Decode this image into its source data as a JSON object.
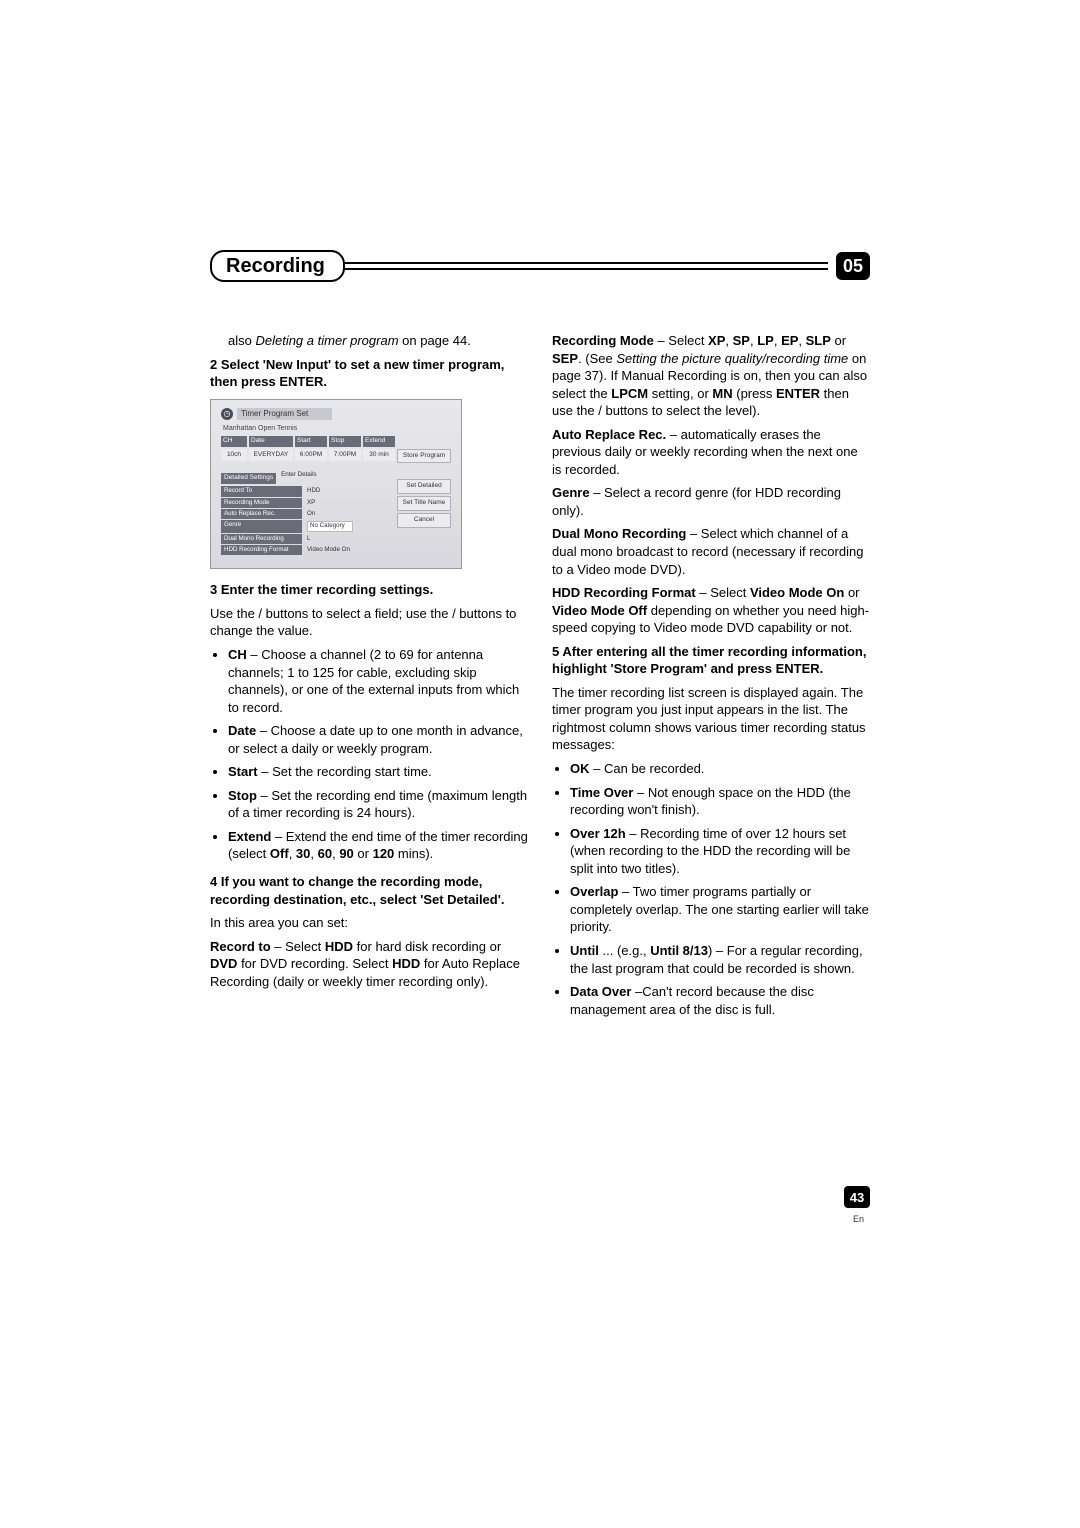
{
  "header": {
    "title": "Recording",
    "chapter": "05"
  },
  "footer": {
    "page": "43",
    "lang": "En"
  },
  "left": {
    "intro_also": "also ",
    "intro_ref_italic": "Deleting a timer program",
    "intro_after": " on page 44.",
    "step2": "2   Select 'New Input' to set a new timer program, then press ENTER.",
    "ui": {
      "panel_title": "Timer Program Set",
      "subtitle": "Manhattan Open Tennis",
      "cols": {
        "ch": "CH",
        "date": "Date",
        "start": "Start",
        "stop": "Stop",
        "extend": "Extend"
      },
      "vals": {
        "ch": "10ch",
        "date": "EVERYDAY",
        "start": "6:00PM",
        "stop": "7:00PM",
        "extend": "30 min"
      },
      "store_btn": "Store Program",
      "detailed_hdr": "Detailed Settings",
      "enter_details": "Enter Details",
      "rows": {
        "record_to_l": "Record To",
        "record_to_v": "HDD",
        "rec_mode_l": "Recording Mode",
        "rec_mode_v": "XP",
        "auto_l": "Auto Replace Rec.",
        "auto_v": "On",
        "genre_l": "Genre",
        "genre_v": "No Category",
        "dual_l": "Dual Mono Recording",
        "dual_v": "L",
        "hdd_l": "HDD Recording Format",
        "hdd_v": "Video Mode On"
      },
      "btns": {
        "set_detailed": "Set Detailed",
        "set_title": "Set Title Name",
        "cancel": "Cancel"
      }
    },
    "step3": "3   Enter the timer recording settings.",
    "step3_use": "Use the     /     buttons to select a field; use the     /     buttons to change the value.",
    "bul_ch_b": "CH",
    "bul_ch": " – Choose a channel (2 to 69 for antenna channels; 1 to 125 for cable, excluding skip channels), or one of the external inputs from which to record.",
    "bul_date_b": "Date",
    "bul_date": " – Choose a date up to one month in advance, or select a daily or weekly program.",
    "bul_start_b": "Start",
    "bul_start": " – Set the recording start time.",
    "bul_stop_b": "Stop",
    "bul_stop": " – Set the recording end time (maximum length of a timer recording is 24 hours).",
    "bul_ext_b": "Extend",
    "bul_ext_a": " – Extend the end time of the timer recording (select ",
    "bul_ext_off": "Off",
    "bul_ext_30": "30",
    "bul_ext_60": "60",
    "bul_ext_90": "90",
    "bul_ext_or": " or ",
    "bul_ext_120": "120",
    "bul_ext_mins": " mins).",
    "step4": "4   If you want to change the recording mode, recording destination, etc., select 'Set Detailed'.",
    "step4_p": "In this area you can set:",
    "rec_to_b": "Record to",
    "rec_to_a": " – Select ",
    "rec_to_hdd": "HDD",
    "rec_to_mid": " for hard disk recording or ",
    "rec_to_dvd": "DVD",
    "rec_to_c": " for DVD recording. Select ",
    "rec_to_hdd2": "HDD",
    "rec_to_d": "  for Auto Replace Recording (daily or weekly timer recording only)."
  },
  "right": {
    "rm_b": "Recording Mode",
    "rm_a": " – Select ",
    "rm_xp": "XP",
    "rm_sp": "SP",
    "rm_lp": "LP",
    "rm_ep": "EP",
    "rm_slp": "SLP",
    "rm_or": " or ",
    "rm_sep": "SEP",
    "rm_see": ". (See ",
    "rm_ital": "Setting the picture quality/recording time",
    "rm_pg": " on page 37). If Manual Recording is on, then you can also select the ",
    "rm_lpcm": "LPCM",
    "rm_set": "  setting, or ",
    "rm_mn": "MN",
    "rm_press": " (press ",
    "rm_enter": "ENTER",
    "rm_then": " then use the     /     buttons to select the level).",
    "arr_b": "Auto Replace Rec.",
    "arr_t": " –  automatically erases the previous daily or weekly recording when the next one is recorded.",
    "genre_b": "Genre",
    "genre_t": " – Select a record genre (for HDD recording only).",
    "dual_b": "Dual Mono Recording",
    "dual_t": " – Select which channel of a dual mono broadcast to record (necessary if recording to a Video mode DVD).",
    "hdd_b": "HDD Recording Format",
    "hdd_a": " – Select ",
    "hdd_vmon": "Video Mode On",
    "hdd_or": " or ",
    "hdd_vmoff": "Video Mode Off",
    "hdd_t": " depending on whether you need high-speed copying to Video mode DVD capability or not.",
    "step5": "5   After entering all the timer recording information, highlight 'Store Program' and press ENTER.",
    "step5_p": "The timer recording list screen is displayed again. The timer program you just input appears in the list. The rightmost column shows various timer recording status messages:",
    "b_ok_b": "OK",
    "b_ok": " – Can be recorded.",
    "b_to_b": "Time Over",
    "b_to": " – Not enough space on the HDD (the recording won't finish).",
    "b_12_b": "Over 12h",
    "b_12": " – Recording time of over 12 hours set (when recording to the HDD the recording will be split into two titles).",
    "b_ov_b": "Overlap",
    "b_ov": " – Two timer programs partially or completely overlap. The one starting earlier will take priority.",
    "b_un_b": "Until",
    "b_un_a": " ... (e.g., ",
    "b_un_ex": "Until 8/13",
    "b_un_t": ") – For a regular recording, the last program that could be recorded is shown.",
    "b_do_b": "Data Over",
    "b_do": " –Can't record because the disc management area of the disc is full."
  }
}
